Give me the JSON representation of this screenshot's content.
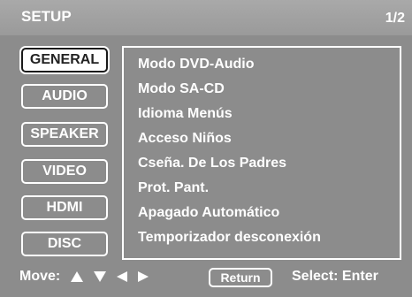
{
  "header": {
    "title": "SETUP",
    "page_indicator": "1/2"
  },
  "sidebar": {
    "items": [
      {
        "label": "GENERAL",
        "active": true
      },
      {
        "label": "AUDIO",
        "active": false
      },
      {
        "label": "SPEAKER",
        "active": false
      },
      {
        "label": "VIDEO",
        "active": false
      },
      {
        "label": "HDMI",
        "active": false
      },
      {
        "label": "DISC",
        "active": false
      }
    ]
  },
  "main": {
    "items": [
      "Modo DVD-Audio",
      "Modo SA-CD",
      "Idioma Menús",
      "Acceso Niños",
      "Cseña. De Los Padres",
      "Prot. Pant.",
      "Apagado Automático",
      "Temporizador desconexión"
    ]
  },
  "footer": {
    "move_label": "Move:",
    "return_label": "Return",
    "select_label": "Select: Enter"
  },
  "colors": {
    "background": "#8c8c8c",
    "header": "#a0a0a0",
    "text": "#ffffff"
  },
  "icons": [
    "arrow-up-icon",
    "arrow-down-icon",
    "arrow-left-icon",
    "arrow-right-icon"
  ]
}
